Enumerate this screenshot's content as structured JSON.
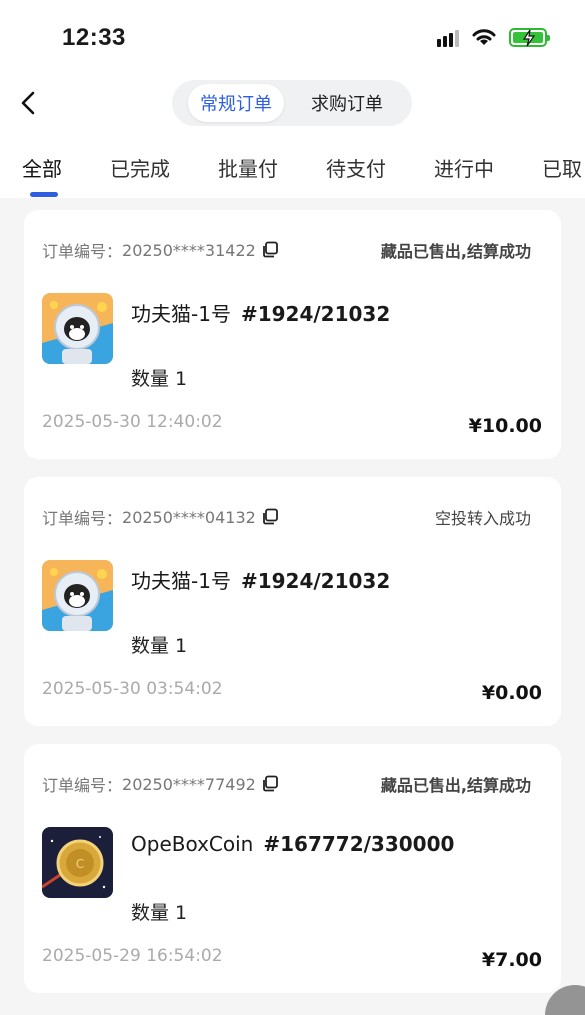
{
  "status_bar": {
    "time": "12:33"
  },
  "segment": {
    "regular": "常规订单",
    "purchase": "求购订单"
  },
  "tabs": [
    "全部",
    "已完成",
    "批量付",
    "待支付",
    "进行中",
    "已取"
  ],
  "order_prefix": "订单编号：",
  "orders": [
    {
      "order_no": "20250****31422",
      "status": "藏品已售出,结算成功",
      "name": "功夫猫-1号",
      "serial": "#1924/21032",
      "qty": "数量 1",
      "date": "2025-05-30 12:40:02",
      "price": "¥10.00",
      "thumb": "cat-astronaut"
    },
    {
      "order_no": "20250****04132",
      "status": "空投转入成功",
      "name": "功夫猫-1号",
      "serial": "#1924/21032",
      "qty": "数量 1",
      "date": "2025-05-30 03:54:02",
      "price": "¥0.00",
      "thumb": "cat-astronaut"
    },
    {
      "order_no": "20250****77492",
      "status": "藏品已售出,结算成功",
      "name": "OpeBoxCoin",
      "serial": "#167772/330000",
      "qty": "数量 1",
      "date": "2025-05-29 16:54:02",
      "price": "¥7.00",
      "thumb": "gold-coin"
    }
  ],
  "colors": {
    "accent": "#2f5fe0",
    "battery": "#34c338"
  }
}
